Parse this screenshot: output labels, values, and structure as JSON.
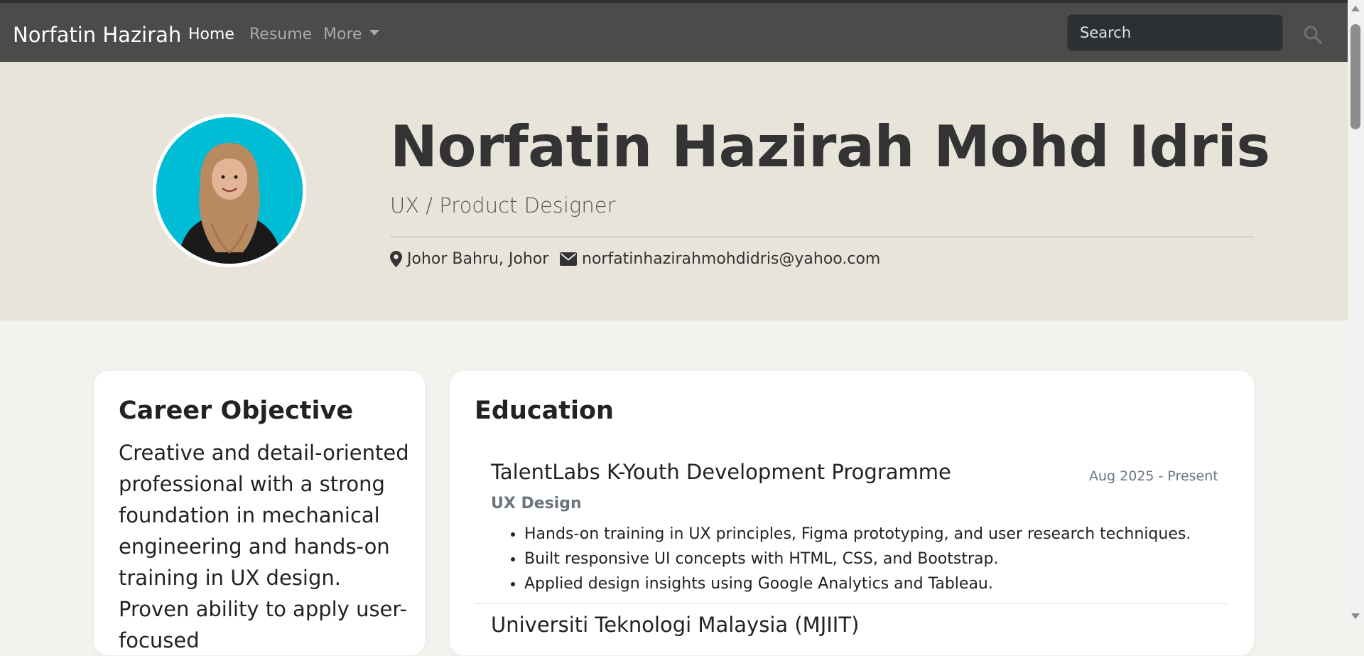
{
  "navbar": {
    "brand": "Norfatin Hazirah",
    "links": [
      "Home",
      "Resume",
      "More"
    ],
    "search_placeholder": "Search"
  },
  "hero": {
    "name": "Norfatin Hazirah Mohd Idris",
    "title": "UX / Product Designer",
    "location": "Johor Bahru, Johor",
    "email": "norfatinhazirahmohdidris@yahoo.com"
  },
  "objective": {
    "heading": "Career Objective",
    "text": "Creative and detail-oriented professional with a strong foundation in mechanical engineering and hands-on training in UX design. Proven ability to apply user-focused"
  },
  "education": {
    "heading": "Education",
    "entries": [
      {
        "school": "TalentLabs K-Youth Development Programme",
        "dates": "Aug 2025 - Present",
        "field": "UX Design",
        "bullets": [
          "Hands-on training in UX principles, Figma prototyping, and user research techniques.",
          "Built responsive UI concepts with HTML, CSS, and Bootstrap.",
          "Applied design insights using Google Analytics and Tableau."
        ]
      },
      {
        "school": "Universiti Teknologi Malaysia (MJIIT)"
      }
    ]
  },
  "colors": {
    "navbar": "#4b4b4b",
    "hero_bg": "#e8e4da",
    "page_bg": "#f3f2ee",
    "avatar_bg": "#00bcd4"
  }
}
